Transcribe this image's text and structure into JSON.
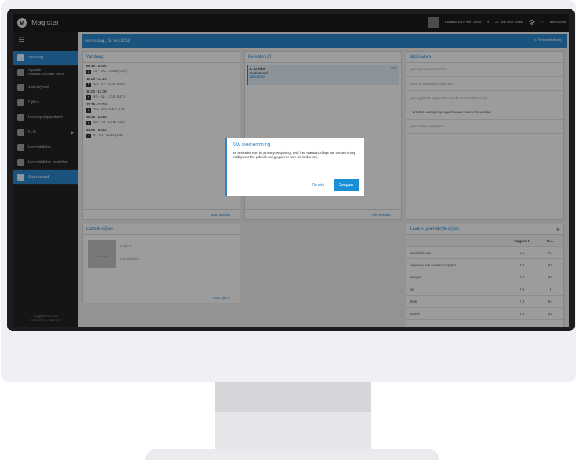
{
  "app": {
    "title": "Magister"
  },
  "topbar": {
    "user_name": "Dannie van der Staal",
    "child_name": "H. van der Staal",
    "logout_label": "Afmelden"
  },
  "sidebar": {
    "items": [
      {
        "label": "Vandaag",
        "icon": "home-icon",
        "active": true
      },
      {
        "label": "Agenda",
        "sub": "Dannie van der Staal",
        "icon": "calendar-icon"
      },
      {
        "label": "Afwezigheid",
        "icon": "check-icon"
      },
      {
        "label": "Cijfers",
        "icon": "grades-icon"
      },
      {
        "label": "Leerlingvolgsysteem",
        "icon": "student-icon"
      },
      {
        "label": "ELO",
        "icon": "elo-icon",
        "arrow": true
      },
      {
        "label": "Leermiddelen",
        "icon": "books-icon"
      },
      {
        "label": "Leermiddelen bestellen",
        "icon": "cart-icon"
      },
      {
        "label": "Ouderavond",
        "icon": "parents-icon",
        "active": true
      }
    ],
    "footer": [
      "Magister v6.1.28",
      "Beoordelen Activeren"
    ]
  },
  "date_bar": {
    "label": "woensdag, 15 mei 2019",
    "edit_label": "Schermindeling"
  },
  "vandaag": {
    "title": "Vandaag",
    "lessons": [
      {
        "time": "09:15 - 10:05",
        "num": "1",
        "desc": "LO - WO - LV4B (LO4)"
      },
      {
        "time": "10:20 - 11:10",
        "num": "3",
        "desc": "NA - BP - LV4B (L92)"
      },
      {
        "time": "11:10 - 12:05",
        "num": "4",
        "desc": "NE - NL - LV4B (L17)"
      },
      {
        "time": "12:25 - 13:15",
        "num": "5",
        "desc": "EN - NO - LV4B (L28)"
      },
      {
        "time": "13:15 - 14:05",
        "num": "6",
        "desc": "EN - AG - LV4B (L31)"
      },
      {
        "time": "14:20 - 15:10",
        "num": "7",
        "desc": "DI - NL - LV4B (L40)"
      }
    ],
    "footer": "Naar agenda"
  },
  "berichten": {
    "title": "Berichten (0)",
    "message": {
      "from": "D. Druijter",
      "subject": "Ouderavond",
      "folder": "Meldingen",
      "time": "8:47"
    },
    "footer": "Alle berichten"
  },
  "notificaties": {
    "title": "Notificaties",
    "items": [
      {
        "text": "geen gemelde opdrachten",
        "bold": false
      },
      {
        "text": "geen beoordeelde opdrachten",
        "bold": false
      },
      {
        "text": "geen geplande opdrachten voor binnen instelde termijn",
        "bold": false
      },
      {
        "text": "1 activiteit waarop nog ingeschreven moet of kan worden",
        "bold": true
      },
      {
        "text": "geen nieuwe logboeken",
        "bold": false
      }
    ]
  },
  "laatste_cijfers": {
    "title": "Laatste cijfers",
    "recent_box": "Geen cijfers",
    "recent_label": "0 cijfers",
    "recent_sub": "Lijst bekijken",
    "footer": "Naar cijfers"
  },
  "gemiddelde": {
    "title": "Laatste gemiddelde cijfers",
    "header": [
      "",
      "Rapport 3",
      "Ge..."
    ],
    "rows": [
      [
        "aardrijkskunde",
        "6,5",
        "7,4"
      ],
      [
        "algemene natuurwetenschappen",
        "7,8",
        "8,1"
      ],
      [
        "biologie",
        "7,2",
        "8,0"
      ],
      [
        "drv",
        "7,8",
        "8"
      ],
      [
        "Duits",
        "7,3",
        "6,4"
      ],
      [
        "Engels",
        "6,9",
        "6,5"
      ]
    ]
  },
  "modal": {
    "title": "Uw toestemming",
    "body": "In het kader van de privacy-wetgeving heeft het Wanda College uw toestemming nodig voor het gebruik van gegevens van uw kind(eren).",
    "no_label": "Nu niet",
    "yes_label": "Doorgaan"
  }
}
